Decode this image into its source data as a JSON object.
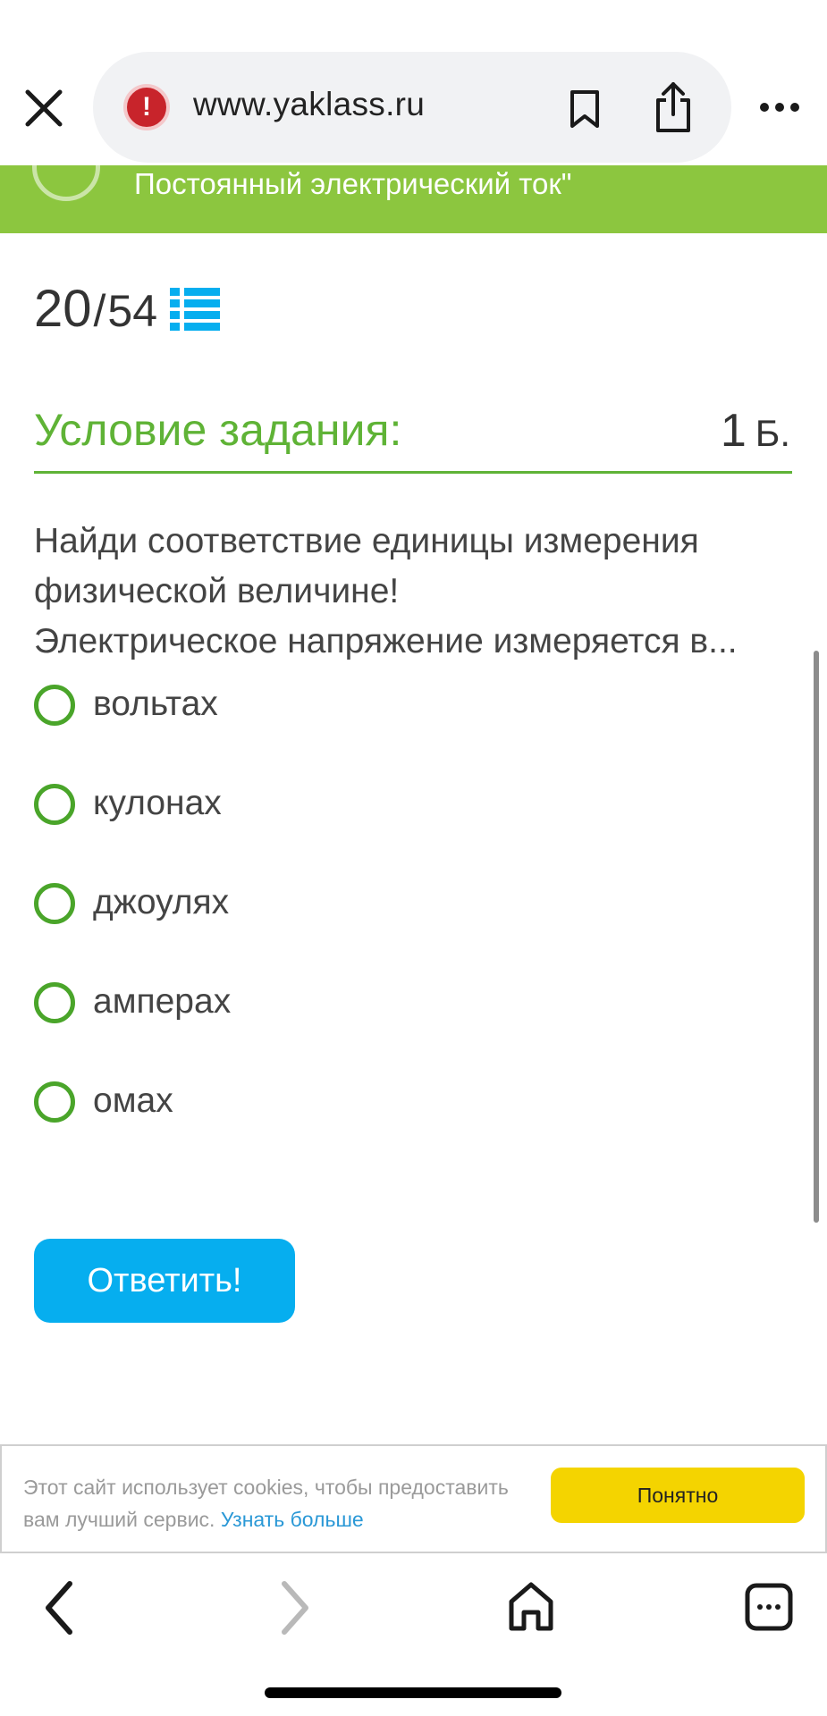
{
  "browser": {
    "url": "www.yaklass.ru",
    "icons": {
      "close": "close-icon",
      "security": "warning-icon",
      "bookmark": "bookmark-icon",
      "share": "share-icon",
      "more": "more-icon"
    }
  },
  "breadcrumb": {
    "title": "Постоянный электрический ток\""
  },
  "progress": {
    "current": "20",
    "separator": "/",
    "total": "54",
    "list_icon": "list-icon"
  },
  "task": {
    "header": "Условие задания:",
    "points_value": "1",
    "points_unit": "Б.",
    "question_lines": [
      "Найди соответствие единицы измерения",
      "физической величине!",
      "Электрическое напряжение измеряется в..."
    ],
    "options": [
      {
        "label": "вольтах",
        "selected": false
      },
      {
        "label": "кулонах",
        "selected": false
      },
      {
        "label": "джоулях",
        "selected": false
      },
      {
        "label": "амперах",
        "selected": false
      },
      {
        "label": "омах",
        "selected": false
      }
    ],
    "submit_label": "Ответить!"
  },
  "cookie_banner": {
    "text": "Этот сайт использует cookies, чтобы предоставить вам лучший сервис.",
    "link_text": "Узнать больше",
    "accept_label": "Понятно"
  },
  "bottom_nav": {
    "icons": [
      "back-icon",
      "forward-icon",
      "home-icon",
      "tabs-icon"
    ]
  },
  "colors": {
    "accent_green": "#5fb336",
    "strip_green": "#8cc63f",
    "button_blue": "#06aeef",
    "cookie_yellow": "#f4d400",
    "link_blue": "#2a98d6",
    "warning_red": "#c8242b"
  }
}
